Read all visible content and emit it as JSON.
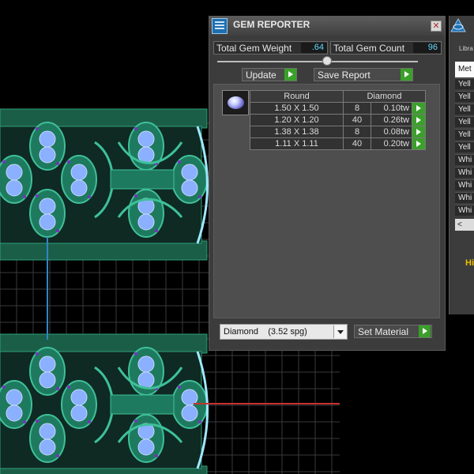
{
  "viewport": {
    "colors": {
      "background": "#000000",
      "grid": "#3a3a3a",
      "metal": "#1e7a5e",
      "gem": "#8ab0ff",
      "prong": "#7a2fc0"
    }
  },
  "gem_reporter": {
    "title": "GEM REPORTER",
    "close_glyph": "✕",
    "total_weight_label": "Total Gem Weight",
    "total_weight_value": ".64",
    "total_count_label": "Total Gem Count",
    "total_count_value": "96",
    "update_label": "Update",
    "save_report_label": "Save Report",
    "headers": {
      "shape": "Round",
      "material": "Diamond"
    },
    "rows": [
      {
        "size": "1.50 X 1.50",
        "qty": "8",
        "weight": "0.10tw"
      },
      {
        "size": "1.20 X 1.20",
        "qty": "40",
        "weight": "0.26tw"
      },
      {
        "size": "1.38 X 1.38",
        "qty": "8",
        "weight": "0.08tw"
      },
      {
        "size": "1.11 X 1.11",
        "qty": "40",
        "weight": "0.20tw"
      }
    ],
    "material_select": "Diamond    (3.52 spg)",
    "set_material_label": "Set Material",
    "accent": "#3aa02a"
  },
  "library": {
    "tab_label": "Libra",
    "header_label": "Met",
    "items": [
      "Yell",
      "Yell",
      "Yell",
      "Yell",
      "Yell",
      "Yell",
      "Whi",
      "Whi",
      "Whi",
      "Whi",
      "Whi"
    ],
    "scroll_left_glyph": "<",
    "highlight_label": "Hi"
  }
}
